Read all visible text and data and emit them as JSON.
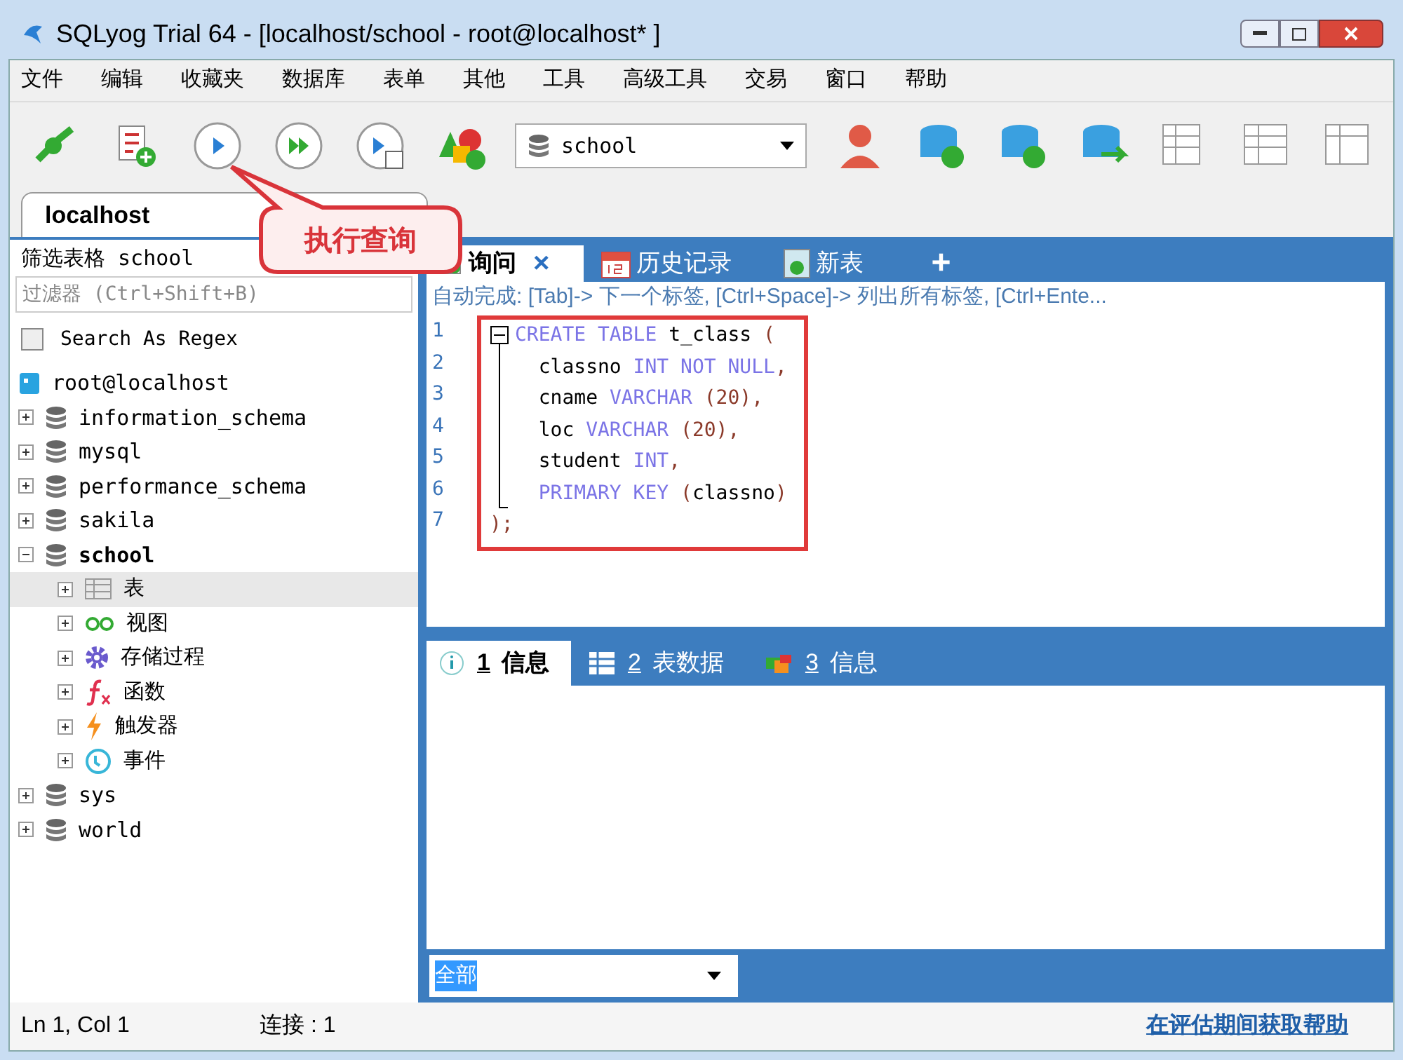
{
  "window": {
    "title": "SQLyog Trial 64 - [localhost/school - root@localhost* ]"
  },
  "menu": [
    "文件",
    "编辑",
    "收藏夹",
    "数据库",
    "表单",
    "其他",
    "工具",
    "高级工具",
    "交易",
    "窗口",
    "帮助"
  ],
  "toolbar": {
    "database_select": "school"
  },
  "callout": {
    "text": "执行查询"
  },
  "connection_tabs": [
    {
      "label": "localhost",
      "selected": true
    }
  ],
  "sidebar": {
    "title": "筛选表格 school",
    "filter": {
      "placeholder": "过滤器 (Ctrl+Shift+B)"
    },
    "regex": {
      "label": "Search As Regex",
      "checked": false
    },
    "tree": [
      {
        "label": "root@localhost",
        "kind": "server",
        "children": [
          {
            "label": "information_schema",
            "kind": "db",
            "expanded": false,
            "active": false,
            "selected": false
          },
          {
            "label": "mysql",
            "kind": "db",
            "expanded": false,
            "active": false,
            "selected": false
          },
          {
            "label": "performance_schema",
            "kind": "db",
            "expanded": false,
            "active": false,
            "selected": false
          },
          {
            "label": "sakila",
            "kind": "db",
            "expanded": false,
            "active": false,
            "selected": false
          },
          {
            "label": "school",
            "kind": "db",
            "expanded": true,
            "active": true,
            "selected": false,
            "children": [
              {
                "label": "表",
                "kind": "table",
                "expanded": false,
                "selected": true
              },
              {
                "label": "视图",
                "kind": "view",
                "expanded": false,
                "selected": false
              },
              {
                "label": "存储过程",
                "kind": "proc",
                "expanded": false,
                "selected": false
              },
              {
                "label": "函数",
                "kind": "func",
                "expanded": false,
                "selected": false
              },
              {
                "label": "触发器",
                "kind": "trigger",
                "expanded": false,
                "selected": false
              },
              {
                "label": "事件",
                "kind": "event",
                "expanded": false,
                "selected": false
              }
            ]
          },
          {
            "label": "sys",
            "kind": "db",
            "expanded": false,
            "active": false,
            "selected": false
          },
          {
            "label": "world",
            "kind": "db",
            "expanded": false,
            "active": false,
            "selected": false
          }
        ]
      }
    ]
  },
  "editor_tabs": [
    {
      "label": "询问",
      "kind": "query",
      "selected": true,
      "close": "×"
    },
    {
      "label": "历史记录",
      "kind": "history",
      "selected": false
    },
    {
      "label": "新表",
      "kind": "newtable",
      "selected": false
    },
    {
      "label": "+",
      "kind": "add",
      "selected": false
    }
  ],
  "hint": "自动完成: [Tab]-> 下一个标签, [Ctrl+Space]-> 列出所有标签, [Ctrl+Ente...",
  "code": [
    {
      "number": "1",
      "tokens": [
        {
          "text": "CREATE TABLE",
          "kind": "keyword"
        },
        {
          "text": " t_class ",
          "kind": "ident"
        },
        {
          "text": "(",
          "kind": "punct"
        }
      ]
    },
    {
      "number": "2",
      "tokens": [
        {
          "text": "  classno ",
          "kind": "ident"
        },
        {
          "text": "INT NOT NULL",
          "kind": "keyword"
        },
        {
          "text": ",",
          "kind": "punct"
        }
      ]
    },
    {
      "number": "3",
      "tokens": [
        {
          "text": "  cname ",
          "kind": "ident"
        },
        {
          "text": "VARCHAR",
          "kind": "keyword"
        },
        {
          "text": " (20),",
          "kind": "punct"
        }
      ]
    },
    {
      "number": "4",
      "tokens": [
        {
          "text": "  loc ",
          "kind": "ident"
        },
        {
          "text": "VARCHAR",
          "kind": "keyword"
        },
        {
          "text": " (20),",
          "kind": "punct"
        }
      ]
    },
    {
      "number": "5",
      "tokens": [
        {
          "text": "  student ",
          "kind": "ident"
        },
        {
          "text": "INT",
          "kind": "keyword"
        },
        {
          "text": ",",
          "kind": "punct"
        }
      ]
    },
    {
      "number": "6",
      "tokens": [
        {
          "text": "  PRIMARY KEY",
          "kind": "keyword"
        },
        {
          "text": " (",
          "kind": "punct"
        },
        {
          "text": "classno",
          "kind": "ident"
        },
        {
          "text": ")",
          "kind": "punct"
        }
      ]
    },
    {
      "number": "7",
      "tokens": [
        {
          "text": ");",
          "kind": "punct"
        }
      ]
    }
  ],
  "result_tabs": [
    {
      "number": "1",
      "label": "信息",
      "kind": "info",
      "selected": true
    },
    {
      "number": "2",
      "label": "表数据",
      "kind": "data",
      "selected": false
    },
    {
      "number": "3",
      "label": "信息",
      "kind": "info2",
      "selected": false
    }
  ],
  "filter_select": "全部",
  "status_bar": {
    "position": "Ln 1, Col 1",
    "connections": "连接 : 1",
    "help_link": "在评估期间获取帮助"
  }
}
